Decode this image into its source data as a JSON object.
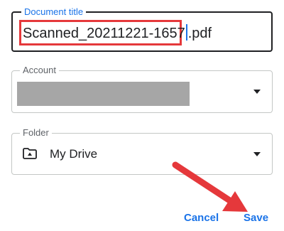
{
  "dialog": {
    "document_title": {
      "label": "Document title",
      "value_before_cursor": "Scanned_20211221-1657",
      "value_after_cursor": ".pdf"
    },
    "account": {
      "label": "Account"
    },
    "folder": {
      "label": "Folder",
      "value": "My Drive",
      "icon": "shared-drive-folder-icon"
    },
    "actions": {
      "cancel_label": "Cancel",
      "save_label": "Save"
    }
  },
  "colors": {
    "accent": "#1a73e8",
    "highlight": "#e5383b",
    "redaction": "#a6a6a6"
  }
}
